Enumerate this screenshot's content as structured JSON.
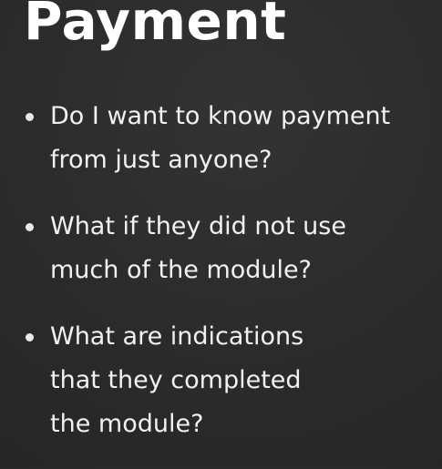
{
  "slide": {
    "title": "Payment",
    "bullets": [
      {
        "lines": [
          "Do I want to know payment",
          "from just anyone?"
        ]
      },
      {
        "lines": [
          "What if they did not use",
          "much of the module?"
        ]
      },
      {
        "lines": [
          "What are indications",
          "that they completed",
          "the module?"
        ]
      }
    ],
    "colors": {
      "background": "#2b2b2b",
      "title": "#ffffff",
      "text": "#f1f1f1"
    }
  }
}
